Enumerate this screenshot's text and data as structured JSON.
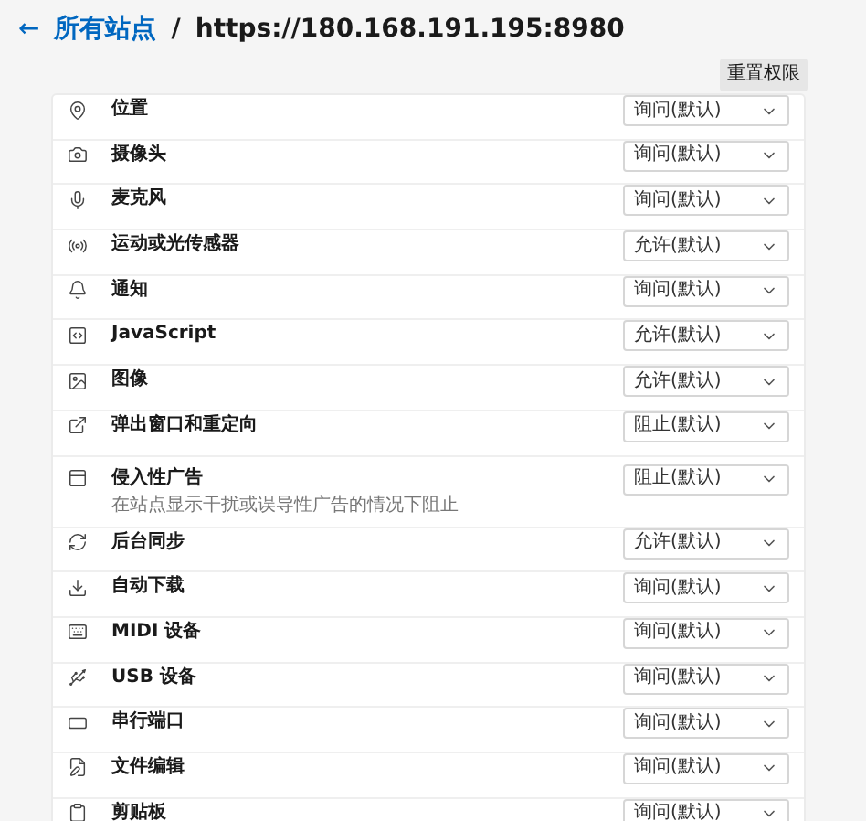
{
  "header": {
    "back": "←",
    "parent": "所有站点",
    "separator": "/",
    "current": "https://180.168.191.195:8980"
  },
  "reset_button": "重置权限",
  "permissions": [
    {
      "label": "位置",
      "value": "询问(默认)"
    },
    {
      "label": "摄像头",
      "value": "询问(默认)"
    },
    {
      "label": "麦克风",
      "value": "询问(默认)"
    },
    {
      "label": "运动或光传感器",
      "value": "允许(默认)"
    },
    {
      "label": "通知",
      "value": "询问(默认)"
    },
    {
      "label": "JavaScript",
      "value": "允许(默认)"
    },
    {
      "label": "图像",
      "value": "允许(默认)"
    },
    {
      "label": "弹出窗口和重定向",
      "value": "阻止(默认)"
    },
    {
      "label": "侵入性广告",
      "description": "在站点显示干扰或误导性广告的情况下阻止",
      "value": "阻止(默认)"
    },
    {
      "label": "后台同步",
      "value": "允许(默认)"
    },
    {
      "label": "自动下载",
      "value": "询问(默认)"
    },
    {
      "label": "MIDI 设备",
      "value": "询问(默认)"
    },
    {
      "label": "USB 设备",
      "value": "询问(默认)"
    },
    {
      "label": "串行端口",
      "value": "询问(默认)"
    },
    {
      "label": "文件编辑",
      "value": "询问(默认)"
    },
    {
      "label": "剪贴板",
      "value": "询问(默认)"
    }
  ]
}
